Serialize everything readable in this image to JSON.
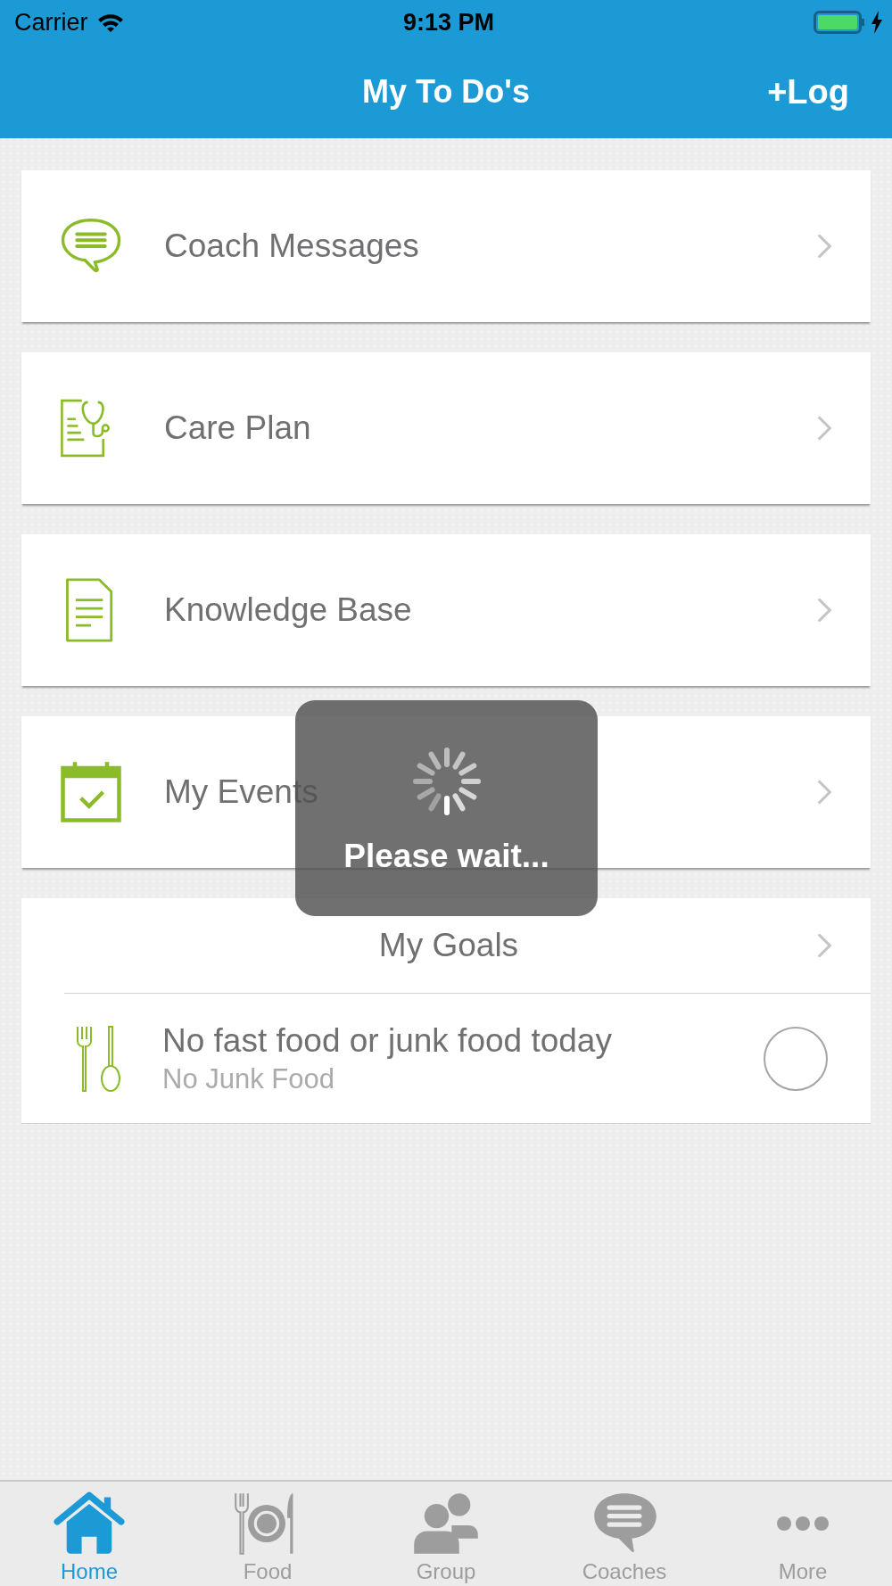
{
  "status_bar": {
    "carrier": "Carrier",
    "time": "9:13 PM",
    "charging": true
  },
  "nav_bar": {
    "title": "My To Do's",
    "action": "+Log"
  },
  "menu_items": [
    {
      "label": "Coach Messages"
    },
    {
      "label": "Care Plan"
    },
    {
      "label": "Knowledge Base"
    },
    {
      "label": "My Events"
    }
  ],
  "goals": {
    "title": "My Goals",
    "items": [
      {
        "title": "No fast food or junk food today",
        "subtitle": "No Junk Food",
        "checked": false
      }
    ]
  },
  "loading": {
    "message": "Please wait..."
  },
  "tab_bar": [
    {
      "label": "Home",
      "selected": true
    },
    {
      "label": "Food",
      "selected": false
    },
    {
      "label": "Group",
      "selected": false
    },
    {
      "label": "Coaches",
      "selected": false
    },
    {
      "label": "More",
      "selected": false
    }
  ]
}
